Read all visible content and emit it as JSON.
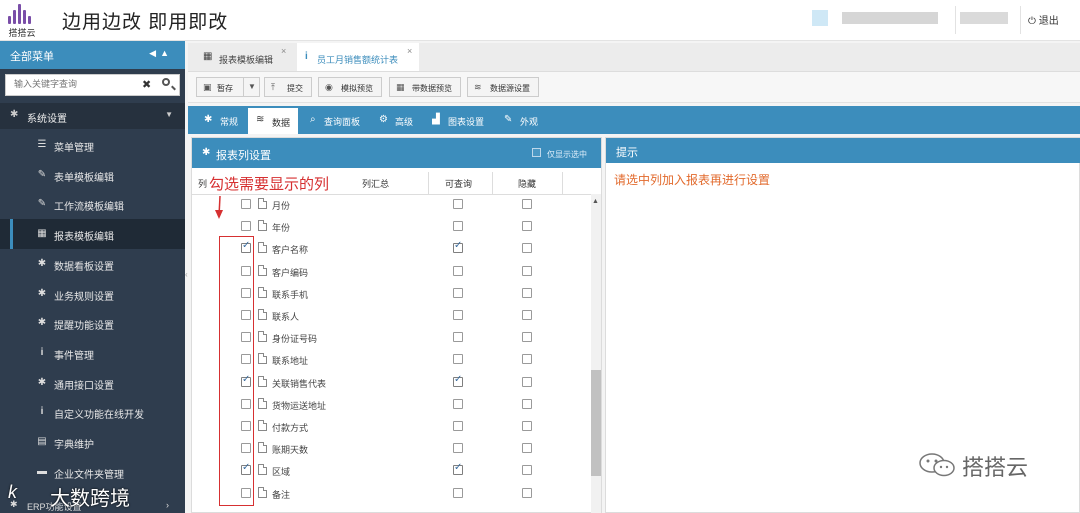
{
  "header": {
    "logo_text": "搭搭云",
    "slogan": "边用边改 即用即改",
    "logout_label": "退出"
  },
  "sidebar": {
    "title": "全部菜单",
    "search_placeholder": "输入关键字查询",
    "section": "系统设置",
    "items": [
      {
        "label": "菜单管理",
        "icon": "list-icon"
      },
      {
        "label": "表单模板编辑",
        "icon": "edit-icon"
      },
      {
        "label": "工作流模板编辑",
        "icon": "edit-icon"
      },
      {
        "label": "报表模板编辑",
        "icon": "table-icon",
        "active": true
      },
      {
        "label": "数据看板设置",
        "icon": "gear-icon"
      },
      {
        "label": "业务规则设置",
        "icon": "gear-icon"
      },
      {
        "label": "提醒功能设置",
        "icon": "gear-icon"
      },
      {
        "label": "事件管理",
        "icon": "info-icon"
      },
      {
        "label": "通用接口设置",
        "icon": "gear-icon"
      },
      {
        "label": "自定义功能在线开发",
        "icon": "info-icon"
      },
      {
        "label": "字典维护",
        "icon": "keyboard-icon"
      },
      {
        "label": "企业文件夹管理",
        "icon": "folder-icon"
      }
    ],
    "bottom_item": "ERP功能设置"
  },
  "tabs": [
    {
      "label": "报表模板编辑",
      "icon": "table-icon"
    },
    {
      "label": "员工月销售额统计表",
      "icon": "info-icon"
    }
  ],
  "toolbar": {
    "save": "暂存",
    "submit": "提交",
    "preview": "模拟预览",
    "data_preview": "带数据预览",
    "datasource": "数据源设置"
  },
  "config_tabs": [
    {
      "label": "常规",
      "icon": "gear-icon"
    },
    {
      "label": "数据",
      "icon": "database-icon"
    },
    {
      "label": "查询面板",
      "icon": "search-icon"
    },
    {
      "label": "高级",
      "icon": "gears-icon"
    },
    {
      "label": "图表设置",
      "icon": "chart-icon"
    },
    {
      "label": "外观",
      "icon": "magic-icon"
    }
  ],
  "column_panel": {
    "title": "报表列设置",
    "only_selected": "仅显示选中",
    "headers": {
      "col": "列",
      "agg": "列汇总",
      "queryable": "可查询",
      "hidden": "隐藏"
    },
    "rows": [
      {
        "label": "月份",
        "checked": false,
        "queryable": false,
        "hidden": false
      },
      {
        "label": "年份",
        "checked": false,
        "queryable": false,
        "hidden": false
      },
      {
        "label": "客户名称",
        "checked": true,
        "queryable": true,
        "hidden": false
      },
      {
        "label": "客户编码",
        "checked": false,
        "queryable": false,
        "hidden": false
      },
      {
        "label": "联系手机",
        "checked": false,
        "queryable": false,
        "hidden": false
      },
      {
        "label": "联系人",
        "checked": false,
        "queryable": false,
        "hidden": false
      },
      {
        "label": "身份证号码",
        "checked": false,
        "queryable": false,
        "hidden": false
      },
      {
        "label": "联系地址",
        "checked": false,
        "queryable": false,
        "hidden": false
      },
      {
        "label": "关联销售代表",
        "checked": true,
        "queryable": true,
        "hidden": false
      },
      {
        "label": "货物运送地址",
        "checked": false,
        "queryable": false,
        "hidden": false
      },
      {
        "label": "付款方式",
        "checked": false,
        "queryable": false,
        "hidden": false
      },
      {
        "label": "账期天数",
        "checked": false,
        "queryable": false,
        "hidden": false
      },
      {
        "label": "区域",
        "checked": true,
        "queryable": true,
        "hidden": false
      },
      {
        "label": "备注",
        "checked": false,
        "queryable": false,
        "hidden": false
      }
    ]
  },
  "annotation": "勾选需要显示的列",
  "hint_panel": {
    "title": "提示",
    "message": "请选中列加入报表再进行设置"
  },
  "watermarks": {
    "right": "搭搭云",
    "left": "大数跨境",
    "left_mark": "k"
  },
  "colors": {
    "primary": "#3c8dbc",
    "sidebar": "#2f3d4e",
    "annotation": "#d63031",
    "hint": "#e26a2c"
  }
}
